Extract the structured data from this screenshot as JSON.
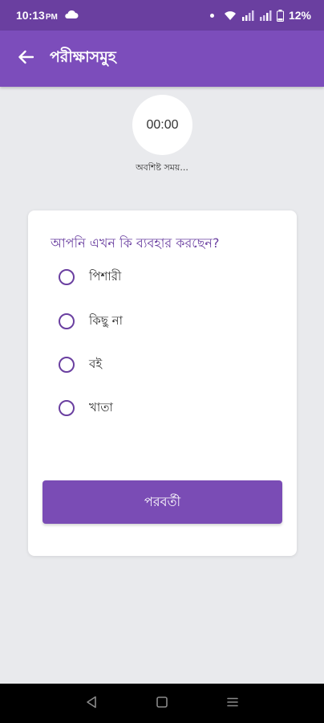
{
  "status_bar": {
    "time": "10:13",
    "ampm": "PM",
    "battery": "12%",
    "icons": [
      "cloud-icon",
      "wifi-icon",
      "signal-icon",
      "signal-icon",
      "battery-icon"
    ]
  },
  "app_bar": {
    "back_icon": "arrow-left-icon",
    "title": "পরীক্ষাসমুহ"
  },
  "timer": {
    "value": "00:00",
    "label": "অবশিষ্ট সময়..."
  },
  "quiz": {
    "question": "আপনি এখন কি ব্যবহার করছেন?",
    "options": [
      {
        "label": "পিশারী"
      },
      {
        "label": "কিছু না"
      },
      {
        "label": "বই"
      },
      {
        "label": "খাতা"
      }
    ],
    "next_label": "পরবর্তী"
  },
  "colors": {
    "status_bar": "#6a3fa0",
    "app_bar": "#7c4dbb",
    "accent": "#6a3fa0",
    "button": "#7a4cb5",
    "background": "#e9eaed"
  },
  "nav_bar": {
    "icons": [
      "back-triangle-icon",
      "home-square-icon",
      "recents-lines-icon"
    ]
  }
}
